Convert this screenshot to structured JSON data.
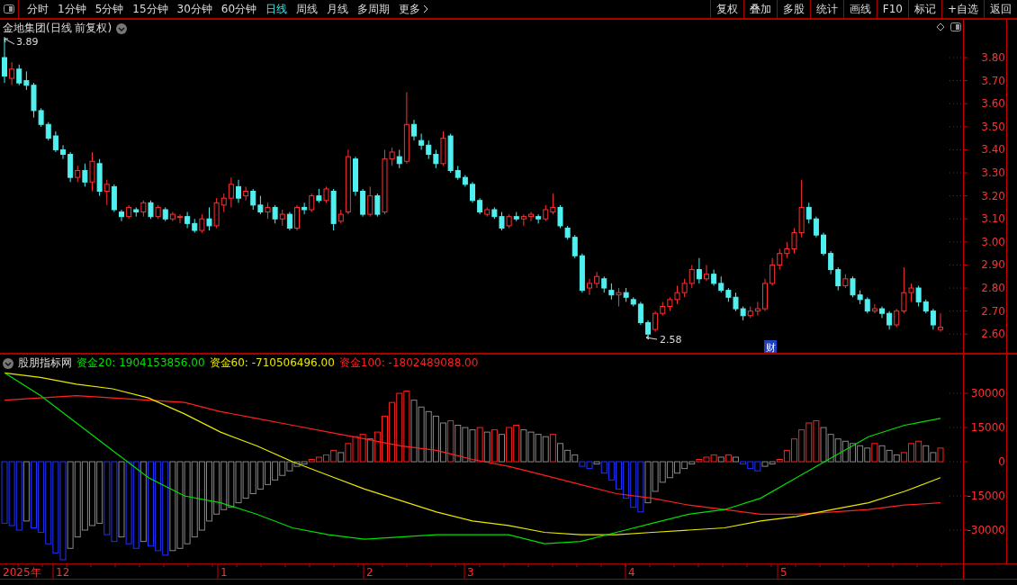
{
  "toolbar": {
    "periods": [
      {
        "label": "分时",
        "selected": false
      },
      {
        "label": "1分钟",
        "selected": false
      },
      {
        "label": "5分钟",
        "selected": false
      },
      {
        "label": "15分钟",
        "selected": false
      },
      {
        "label": "30分钟",
        "selected": false
      },
      {
        "label": "60分钟",
        "selected": false
      },
      {
        "label": "日线",
        "selected": true
      },
      {
        "label": "周线",
        "selected": false
      },
      {
        "label": "月线",
        "selected": false
      },
      {
        "label": "多周期",
        "selected": false
      },
      {
        "label": "更多",
        "selected": false
      }
    ],
    "buttons": [
      "复权",
      "叠加",
      "多股",
      "统计",
      "画线",
      "F10",
      "标记",
      "+自选",
      "返回"
    ]
  },
  "price_chart": {
    "title": "金地集团(日线 前复权)",
    "high_label": "3.89",
    "low_label": "2.58",
    "event_badge": "财",
    "chart_data": {
      "type": "candlestick",
      "ylim": [
        2.515,
        3.968
      ],
      "yticks": [
        {
          "value": 3.8,
          "label": "3.80"
        },
        {
          "value": 3.7,
          "label": "3.70"
        },
        {
          "value": 3.6,
          "label": "3.60"
        },
        {
          "value": 3.5,
          "label": "3.50"
        },
        {
          "value": 3.4,
          "label": "3.40"
        },
        {
          "value": 3.3,
          "label": "3.30"
        },
        {
          "value": 3.2,
          "label": "3.20"
        },
        {
          "value": 3.1,
          "label": "3.10"
        },
        {
          "value": 3.0,
          "label": "3.00"
        },
        {
          "value": 2.9,
          "label": "2.90"
        },
        {
          "value": 2.8,
          "label": "2.80"
        },
        {
          "value": 2.7,
          "label": "2.70"
        },
        {
          "value": 2.6,
          "label": "2.60"
        }
      ],
      "ohlc": [
        [
          3.8,
          3.89,
          3.69,
          3.72
        ],
        [
          3.71,
          3.78,
          3.68,
          3.75
        ],
        [
          3.75,
          3.77,
          3.68,
          3.69
        ],
        [
          3.7,
          3.74,
          3.66,
          3.68
        ],
        [
          3.68,
          3.69,
          3.54,
          3.57
        ],
        [
          3.57,
          3.58,
          3.5,
          3.51
        ],
        [
          3.51,
          3.52,
          3.44,
          3.45
        ],
        [
          3.46,
          3.48,
          3.39,
          3.4
        ],
        [
          3.4,
          3.42,
          3.36,
          3.38
        ],
        [
          3.38,
          3.39,
          3.26,
          3.28
        ],
        [
          3.28,
          3.33,
          3.26,
          3.31
        ],
        [
          3.31,
          3.34,
          3.24,
          3.26
        ],
        [
          3.26,
          3.39,
          3.22,
          3.35
        ],
        [
          3.34,
          3.36,
          3.2,
          3.22
        ],
        [
          3.22,
          3.27,
          3.16,
          3.25
        ],
        [
          3.24,
          3.25,
          3.13,
          3.14
        ],
        [
          3.13,
          3.14,
          3.09,
          3.11
        ],
        [
          3.11,
          3.16,
          3.1,
          3.15
        ],
        [
          3.14,
          3.15,
          3.11,
          3.13
        ],
        [
          3.13,
          3.18,
          3.11,
          3.17
        ],
        [
          3.17,
          3.18,
          3.1,
          3.11
        ],
        [
          3.11,
          3.16,
          3.1,
          3.15
        ],
        [
          3.14,
          3.15,
          3.09,
          3.1
        ],
        [
          3.1,
          3.13,
          3.09,
          3.12
        ],
        [
          3.11,
          3.12,
          3.08,
          3.11
        ],
        [
          3.11,
          3.13,
          3.06,
          3.08
        ],
        [
          3.08,
          3.1,
          3.04,
          3.05
        ],
        [
          3.05,
          3.12,
          3.04,
          3.1
        ],
        [
          3.1,
          3.15,
          3.05,
          3.07
        ],
        [
          3.07,
          3.19,
          3.06,
          3.17
        ],
        [
          3.16,
          3.21,
          3.13,
          3.19
        ],
        [
          3.19,
          3.28,
          3.15,
          3.25
        ],
        [
          3.24,
          3.27,
          3.17,
          3.19
        ],
        [
          3.2,
          3.24,
          3.18,
          3.22
        ],
        [
          3.22,
          3.23,
          3.14,
          3.16
        ],
        [
          3.16,
          3.2,
          3.12,
          3.13
        ],
        [
          3.13,
          3.17,
          3.1,
          3.15
        ],
        [
          3.15,
          3.16,
          3.08,
          3.1
        ],
        [
          3.1,
          3.14,
          3.07,
          3.12
        ],
        [
          3.12,
          3.13,
          3.05,
          3.06
        ],
        [
          3.06,
          3.16,
          3.05,
          3.15
        ],
        [
          3.15,
          3.17,
          3.12,
          3.14
        ],
        [
          3.14,
          3.21,
          3.13,
          3.2
        ],
        [
          3.2,
          3.23,
          3.17,
          3.18
        ],
        [
          3.18,
          3.24,
          3.17,
          3.23
        ],
        [
          3.22,
          3.23,
          3.05,
          3.08
        ],
        [
          3.09,
          3.14,
          3.08,
          3.12
        ],
        [
          3.13,
          3.4,
          3.12,
          3.37
        ],
        [
          3.36,
          3.37,
          3.2,
          3.22
        ],
        [
          3.22,
          3.23,
          3.11,
          3.12
        ],
        [
          3.12,
          3.24,
          3.11,
          3.2
        ],
        [
          3.2,
          3.21,
          3.11,
          3.12
        ],
        [
          3.13,
          3.4,
          3.12,
          3.36
        ],
        [
          3.36,
          3.41,
          3.33,
          3.39
        ],
        [
          3.37,
          3.4,
          3.32,
          3.34
        ],
        [
          3.35,
          3.65,
          3.34,
          3.51
        ],
        [
          3.51,
          3.53,
          3.44,
          3.46
        ],
        [
          3.44,
          3.47,
          3.4,
          3.42
        ],
        [
          3.42,
          3.44,
          3.36,
          3.38
        ],
        [
          3.38,
          3.4,
          3.32,
          3.34
        ],
        [
          3.34,
          3.48,
          3.33,
          3.45
        ],
        [
          3.46,
          3.47,
          3.3,
          3.31
        ],
        [
          3.31,
          3.33,
          3.27,
          3.28
        ],
        [
          3.28,
          3.29,
          3.24,
          3.25
        ],
        [
          3.25,
          3.26,
          3.17,
          3.18
        ],
        [
          3.18,
          3.19,
          3.12,
          3.13
        ],
        [
          3.12,
          3.15,
          3.11,
          3.14
        ],
        [
          3.14,
          3.15,
          3.1,
          3.11
        ],
        [
          3.11,
          3.13,
          3.05,
          3.06
        ],
        [
          3.07,
          3.12,
          3.06,
          3.11
        ],
        [
          3.11,
          3.13,
          3.09,
          3.1
        ],
        [
          3.1,
          3.12,
          3.07,
          3.11
        ],
        [
          3.11,
          3.13,
          3.09,
          3.12
        ],
        [
          3.11,
          3.12,
          3.08,
          3.1
        ],
        [
          3.1,
          3.16,
          3.09,
          3.14
        ],
        [
          3.13,
          3.21,
          3.12,
          3.15
        ],
        [
          3.15,
          3.16,
          3.06,
          3.07
        ],
        [
          3.06,
          3.07,
          3.01,
          3.02
        ],
        [
          3.02,
          3.03,
          2.93,
          2.94
        ],
        [
          2.94,
          2.95,
          2.78,
          2.79
        ],
        [
          2.8,
          2.84,
          2.77,
          2.82
        ],
        [
          2.82,
          2.87,
          2.8,
          2.85
        ],
        [
          2.84,
          2.85,
          2.78,
          2.8
        ],
        [
          2.79,
          2.82,
          2.75,
          2.77
        ],
        [
          2.77,
          2.8,
          2.72,
          2.78
        ],
        [
          2.78,
          2.8,
          2.74,
          2.76
        ],
        [
          2.75,
          2.76,
          2.72,
          2.73
        ],
        [
          2.73,
          2.74,
          2.64,
          2.65
        ],
        [
          2.65,
          2.66,
          2.58,
          2.6
        ],
        [
          2.62,
          2.7,
          2.61,
          2.69
        ],
        [
          2.69,
          2.74,
          2.68,
          2.72
        ],
        [
          2.72,
          2.76,
          2.7,
          2.75
        ],
        [
          2.75,
          2.81,
          2.73,
          2.78
        ],
        [
          2.78,
          2.84,
          2.76,
          2.82
        ],
        [
          2.82,
          2.9,
          2.8,
          2.88
        ],
        [
          2.88,
          2.93,
          2.82,
          2.84
        ],
        [
          2.84,
          2.9,
          2.83,
          2.86
        ],
        [
          2.86,
          2.88,
          2.81,
          2.82
        ],
        [
          2.82,
          2.85,
          2.78,
          2.79
        ],
        [
          2.79,
          2.8,
          2.74,
          2.76
        ],
        [
          2.76,
          2.78,
          2.7,
          2.71
        ],
        [
          2.71,
          2.72,
          2.66,
          2.68
        ],
        [
          2.68,
          2.72,
          2.67,
          2.7
        ],
        [
          2.7,
          2.74,
          2.68,
          2.71
        ],
        [
          2.71,
          2.84,
          2.7,
          2.82
        ],
        [
          2.82,
          2.93,
          2.81,
          2.9
        ],
        [
          2.9,
          2.97,
          2.88,
          2.95
        ],
        [
          2.95,
          3.0,
          2.93,
          2.97
        ],
        [
          2.97,
          3.06,
          2.95,
          3.04
        ],
        [
          3.04,
          3.27,
          3.02,
          3.15
        ],
        [
          3.15,
          3.17,
          3.08,
          3.1
        ],
        [
          3.1,
          3.11,
          3.02,
          3.03
        ],
        [
          3.03,
          3.04,
          2.94,
          2.95
        ],
        [
          2.95,
          2.96,
          2.86,
          2.88
        ],
        [
          2.88,
          2.89,
          2.79,
          2.81
        ],
        [
          2.81,
          2.86,
          2.8,
          2.84
        ],
        [
          2.84,
          2.85,
          2.76,
          2.77
        ],
        [
          2.77,
          2.79,
          2.73,
          2.75
        ],
        [
          2.75,
          2.76,
          2.69,
          2.7
        ],
        [
          2.7,
          2.73,
          2.69,
          2.71
        ],
        [
          2.71,
          2.72,
          2.67,
          2.69
        ],
        [
          2.69,
          2.7,
          2.62,
          2.64
        ],
        [
          2.64,
          2.71,
          2.63,
          2.7
        ],
        [
          2.7,
          2.89,
          2.69,
          2.78
        ],
        [
          2.78,
          2.82,
          2.74,
          2.8
        ],
        [
          2.8,
          2.81,
          2.72,
          2.74
        ],
        [
          2.74,
          2.75,
          2.69,
          2.7
        ],
        [
          2.7,
          2.71,
          2.62,
          2.64
        ],
        [
          2.62,
          2.69,
          2.61,
          2.63
        ]
      ]
    }
  },
  "indicator": {
    "name": "股朋指标网",
    "legend": [
      {
        "label": "资金20: 1904153856.00",
        "color": "#00e000"
      },
      {
        "label": "资金60: -710506496.00",
        "color": "#e8e800"
      },
      {
        "label": "资金100: -1802489088.00",
        "color": "#ff2020"
      }
    ],
    "histogram": {
      "chart_data": {
        "type": "bar",
        "ylim": [
          -45000,
          47400
        ],
        "yticks": [
          30000,
          15000,
          0,
          -15000,
          -30000
        ],
        "values": [
          -27000,
          -28000,
          -30000,
          -26000,
          -29000,
          -31000,
          -36000,
          -40000,
          -43000,
          -38000,
          -33000,
          -30000,
          -28000,
          -27000,
          -32000,
          -35000,
          -33000,
          -36000,
          -38000,
          -35000,
          -37000,
          -39000,
          -41000,
          -39000,
          -38000,
          -36000,
          -33000,
          -30000,
          -26000,
          -23000,
          -21000,
          -20000,
          -18000,
          -16000,
          -14000,
          -12000,
          -10000,
          -8000,
          -6000,
          -4000,
          -2000,
          -1000,
          1000,
          2000,
          3000,
          5000,
          4000,
          8000,
          11000,
          12000,
          10000,
          13000,
          20000,
          26000,
          30000,
          31000,
          27000,
          24000,
          22000,
          20000,
          17000,
          18000,
          16000,
          15000,
          14000,
          15000,
          13000,
          14000,
          12000,
          15000,
          16000,
          14000,
          13000,
          12000,
          11000,
          12000,
          8000,
          5000,
          3000,
          -2000,
          -3000,
          -1000,
          -5000,
          -8000,
          -12000,
          -16000,
          -20000,
          -22000,
          -18000,
          -13000,
          -9000,
          -7000,
          -5000,
          -3000,
          -1000,
          1000,
          2000,
          3000,
          2000,
          3000,
          2000,
          -1000,
          -3000,
          -4000,
          -2000,
          -1000,
          1000,
          5000,
          10000,
          14000,
          17000,
          18000,
          15000,
          12000,
          10000,
          9000,
          8000,
          7000,
          6000,
          8000,
          7000,
          5000,
          3000,
          4000,
          8000,
          9000,
          7000,
          4000,
          6000
        ]
      }
    },
    "lines": {
      "chart_data": {
        "type": "line",
        "ylim": [
          -45000,
          47400
        ],
        "series": [
          {
            "color": "#ff2020",
            "values": [
              27000,
              28000,
              29000,
              28000,
              27000,
              26000,
              22000,
              19000,
              16000,
              13000,
              10000,
              7000,
              5000,
              1000,
              -2000,
              -6000,
              -10000,
              -14000,
              -16000,
              -19000,
              -21000,
              -23000,
              -23000,
              -22000,
              -21000,
              -19000,
              -18000
            ]
          },
          {
            "color": "#e8e800",
            "values": [
              39000,
              37000,
              34000,
              32000,
              28000,
              21000,
              13000,
              7000,
              0,
              -6000,
              -12000,
              -17000,
              -22000,
              -26000,
              -28000,
              -31000,
              -32000,
              -32000,
              -31000,
              -30000,
              -29000,
              -26000,
              -24000,
              -21000,
              -18000,
              -13000,
              -7000
            ]
          },
          {
            "color": "#00e000",
            "values": [
              39000,
              29000,
              17000,
              5000,
              -7000,
              -15000,
              -18000,
              -23000,
              -29000,
              -32000,
              -34000,
              -33000,
              -32000,
              -32000,
              -32000,
              -36000,
              -35000,
              -31000,
              -27000,
              -23000,
              -21000,
              -16000,
              -7000,
              2000,
              11000,
              16000,
              19000
            ]
          }
        ]
      }
    }
  },
  "date_axis": {
    "labels": [
      "2025年",
      "12",
      "1",
      "2",
      "3",
      "4",
      "5"
    ]
  }
}
